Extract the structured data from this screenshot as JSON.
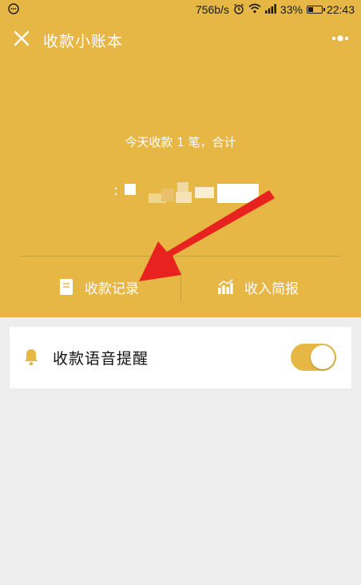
{
  "status_bar": {
    "speed": "756b/s",
    "battery": "33%",
    "time": "22:43",
    "icons": [
      "message-icon",
      "alarm-icon",
      "wifi-icon",
      "signal-icon",
      "battery-icon"
    ]
  },
  "header": {
    "title": "收款小账本",
    "summary": "今天收款 1 笔，合计",
    "amount_prefix": ":",
    "background_color": "#e6b744"
  },
  "actions": [
    {
      "label": "收款记录",
      "icon": "document-icon"
    },
    {
      "label": "收入简报",
      "icon": "bar-chart-icon"
    }
  ],
  "settings": {
    "voice_alert_label": "收款语音提醒",
    "voice_alert_enabled": true,
    "icon": "bell-icon"
  },
  "annotation": {
    "color": "#e8231f",
    "icon": "arrow-icon"
  }
}
